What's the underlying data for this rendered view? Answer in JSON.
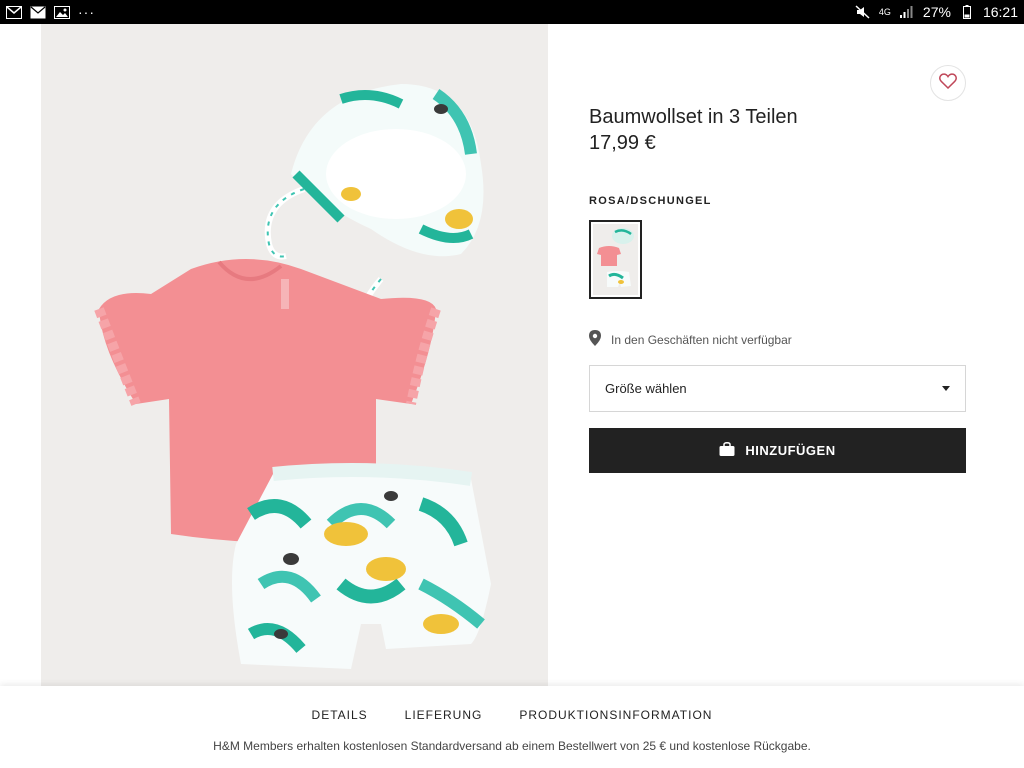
{
  "status_bar": {
    "left_icons": [
      "gmail-icon",
      "mail-icon",
      "image-icon"
    ],
    "overflow": "···",
    "network": "4G",
    "battery_percent": "27%",
    "time": "16:21"
  },
  "product": {
    "title": "Baumwollset in 3 Teilen",
    "price": "17,99 €",
    "color_name": "ROSA/DSCHUNGEL",
    "availability": "In den Geschäften nicht verfügbar",
    "size_select": "Größe wählen",
    "add_button": "HINZUFÜGEN",
    "colors": {
      "shirt": "#f38f93",
      "leaf_green": "#23b59a",
      "leaf_teal": "#3fc4b2",
      "cheetah": "#f0c23a",
      "button_bg": "#222222"
    }
  },
  "tabs": [
    "DETAILS",
    "LIEFERUNG",
    "PRODUKTIONSINFORMATION"
  ],
  "members_note": "H&M Members erhalten kostenlosen Standardversand ab einem Bestellwert von 25 € und kostenlose Rückgabe."
}
